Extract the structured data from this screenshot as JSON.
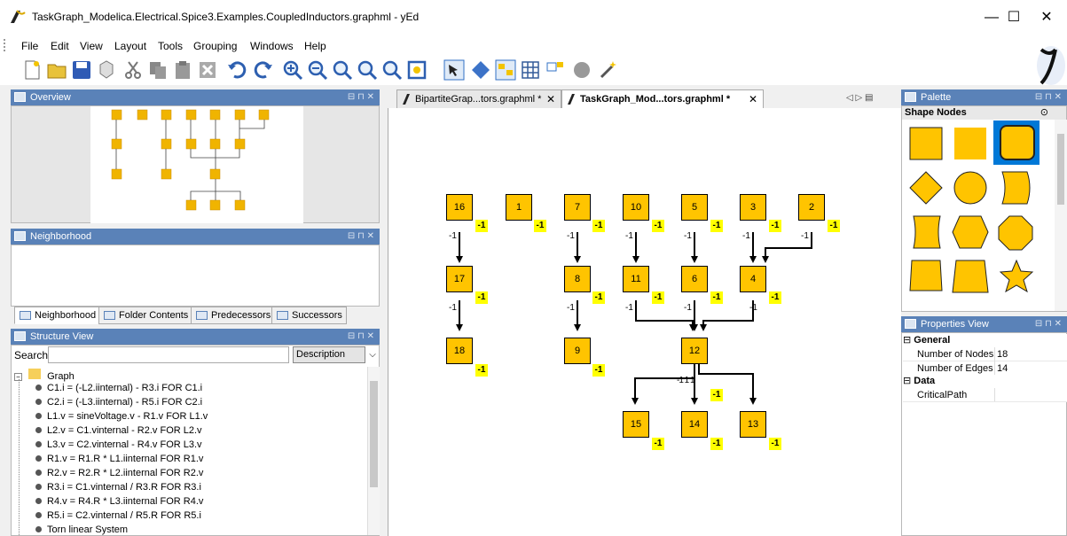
{
  "window": {
    "title": "TaskGraph_Modelica.Electrical.Spice3.Examples.CoupledInductors.graphml - yEd",
    "minimize": "—",
    "maximize": "☐",
    "close": "✕"
  },
  "menu": [
    "File",
    "Edit",
    "View",
    "Layout",
    "Tools",
    "Grouping",
    "Windows",
    "Help"
  ],
  "panels": {
    "overview": "Overview",
    "neighborhood": "Neighborhood",
    "structure": "Structure View",
    "palette": "Palette",
    "properties": "Properties View"
  },
  "neighborhood_tabs": [
    "Neighborhood",
    "Folder Contents",
    "Predecessors",
    "Successors"
  ],
  "structure": {
    "search_label": "Search",
    "search_value": "",
    "mode": "Description",
    "root": "Graph",
    "items": [
      "C1.i = (-L2.iinternal) - R3.i FOR C1.i",
      "C2.i = (-L3.iinternal) - R5.i FOR C2.i",
      "L1.v = sineVoltage.v - R1.v FOR L1.v",
      "L2.v = C1.vinternal - R2.v FOR L2.v",
      "L3.v = C2.vinternal - R4.v FOR L3.v",
      "R1.v = R1.R * L1.iinternal FOR R1.v",
      "R2.v = R2.R * L2.iinternal FOR R2.v",
      "R3.i = C1.vinternal / R3.R FOR R3.i",
      "R4.v = R4.R * L3.iinternal FOR R4.v",
      "R5.i = C2.vinternal / R5.R FOR R5.i",
      "Torn linear System"
    ]
  },
  "doc_tabs": [
    {
      "label": "BipartiteGrap...tors.graphml *",
      "close": "✕"
    },
    {
      "label": "TaskGraph_Mod...tors.graphml *",
      "close": "✕"
    }
  ],
  "tab_nav": "◁ ▷ ▤",
  "graph": {
    "nodes": [
      "16",
      "1",
      "7",
      "10",
      "5",
      "3",
      "2",
      "17",
      "8",
      "11",
      "6",
      "4",
      "18",
      "9",
      "12",
      "15",
      "14",
      "13"
    ],
    "tag": "-1",
    "edge_label": "-1",
    "center_edge_labels": "-1 1 1"
  },
  "palette": {
    "section": "Shape Nodes",
    "shapes": [
      "rectangle",
      "rectangle-flat",
      "rounded-rectangle",
      "diamond",
      "ellipse",
      "card",
      "fat-hexagon",
      "barrel",
      "octagon",
      "parallelogram",
      "trapezoid",
      "star"
    ],
    "fill_color": "#ffc400",
    "selected_color": "#0078d7"
  },
  "properties": {
    "general": "General",
    "rows": [
      {
        "key": "Number of Nodes",
        "value": "18"
      },
      {
        "key": "Number of Edges",
        "value": "14"
      }
    ],
    "data": "Data",
    "data_rows": [
      {
        "key": "CriticalPath",
        "value": ""
      }
    ]
  }
}
